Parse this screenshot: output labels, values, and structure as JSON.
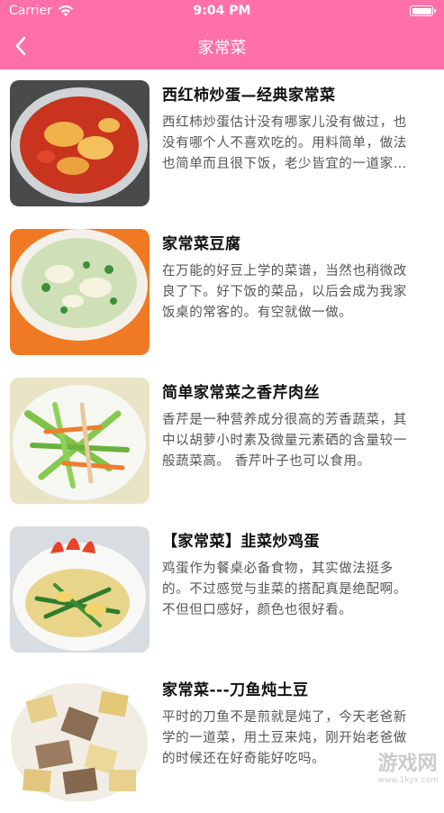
{
  "status_bar": {
    "carrier": "Carrier",
    "time": "9:04 PM",
    "battery_level": 1.0
  },
  "nav": {
    "title": "家常菜"
  },
  "colors": {
    "header": "#ff6fa8",
    "title_text": "#111111",
    "desc_text": "#555555"
  },
  "recipes": [
    {
      "title": "西红柿炒蛋—经典家常菜",
      "desc": "西红柿炒蛋估计没有哪家儿没有做过，也没有哪个人不喜欢吃的。用料简单，做法也简单而且很下饭，老少皆宜的一道家常菜。"
    },
    {
      "title": "家常菜豆腐",
      "desc": "在万能的好豆上学的菜谱，当然也稍微改良了下。好下饭的菜品，以后会成为我家饭桌的常客的。有空就做一做。"
    },
    {
      "title": "简单家常菜之香芹肉丝",
      "desc": "香芹是一种营养成分很高的芳香蔬菜，其中以胡萝小时素及微量元素硒的含量较一般蔬菜高。 香芹叶子也可以食用。"
    },
    {
      "title": "【家常菜】韭菜炒鸡蛋",
      "desc": "鸡蛋作为餐桌必备食物，其实做法挺多的。不过感觉与韭菜的搭配真是绝配啊。不但但口感好，颜色也很好看。"
    },
    {
      "title": "家常菜---刀鱼炖土豆",
      "desc": "平时的刀鱼不是煎就是炖了，今天老爸新学的一道菜，用土豆来炖，刚开始老爸做的时候还在好奇能好吃吗。"
    }
  ],
  "watermark": {
    "text": "游戏网",
    "url": "www.1kyx.com"
  }
}
